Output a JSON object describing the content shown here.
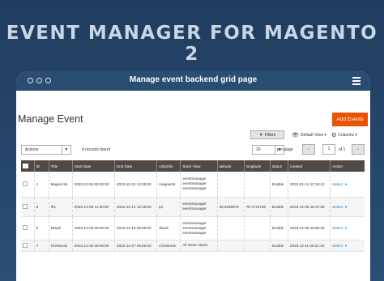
{
  "banner": {
    "title": "EVENT MANAGER FOR MAGENTO 2"
  },
  "browser": {
    "bar_title": "Manage event backend grid page"
  },
  "page": {
    "title": "Manage Event",
    "add_button": "Add Events"
  },
  "toolbar": {
    "filters": "Filters",
    "default_view": "Default View",
    "columns": "Columns",
    "actions": "Actions",
    "records_found": "4 records found",
    "per_page_value": "20",
    "per_page_label": "per page",
    "page_current": "1",
    "page_of": "of 1"
  },
  "grid": {
    "columns": [
      "ID",
      "Title",
      "Start Date",
      "End Date",
      "Urlprefix",
      "Store View",
      "latitude",
      "longitude",
      "status",
      "created",
      "Action"
    ],
    "rows": [
      {
        "id": "1",
        "title": "MageAnts",
        "start": "2023-12-04 05:00:00",
        "end": "2023-12-31 12:26:00",
        "urlprefix": "mageants",
        "store": [
          "eventmanager",
          "eventmanager",
          "eventmanager"
        ],
        "lat": "",
        "lng": "",
        "status": "Enable",
        "created": "2022-01-13 12:19:12",
        "action": "Select"
      },
      {
        "id": "5",
        "title": "IPL",
        "start": "2023-12-06 11:00:00",
        "end": "2023-12-14 12:19:00",
        "urlprefix": "ipl",
        "store": [
          "eventmanager",
          "eventmanager"
        ],
        "lat": "35.5339976",
        "lng": "76.7178726",
        "status": "Enable",
        "created": "2023-12-05 16:47:05",
        "action": "Select"
      },
      {
        "id": "6",
        "title": "Diwali",
        "start": "2023-12-05 05:00:00",
        "end": "2023-12-19 05:00:00",
        "urlprefix": "diwali",
        "store": [
          "eventmanager",
          "eventmanager",
          "eventmanager"
        ],
        "lat": "",
        "lng": "",
        "status": "Enable",
        "created": "2023-12-05 16:56:40",
        "action": "Select"
      },
      {
        "id": "7",
        "title": "Christmas",
        "start": "2023-12-20 06:00:00",
        "end": "2023-12-27 05:00:00",
        "urlprefix": "Christmas",
        "store": [
          "All Store Views"
        ],
        "lat": "",
        "lng": "",
        "status": "Enable",
        "created": "2023-12-11 06:21:40",
        "action": "Select"
      }
    ]
  },
  "colors": {
    "accent": "#eb5202",
    "header": "#514943",
    "banner_bg": "#1f3d5f",
    "link": "#007bdb"
  }
}
